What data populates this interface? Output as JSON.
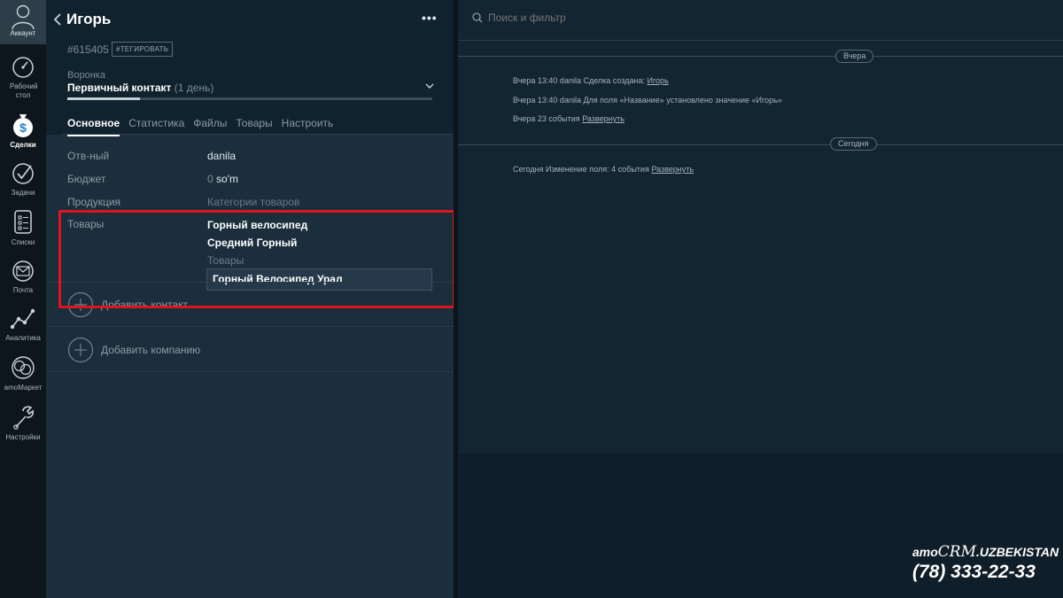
{
  "nav": {
    "account_label": "Аккаунт",
    "items": [
      {
        "id": "dashboard",
        "label": "Рабочий стол",
        "icon": "speedometer-icon"
      },
      {
        "id": "deals",
        "label": "Сделки",
        "icon": "money-bag-icon",
        "active": true
      },
      {
        "id": "tasks",
        "label": "Задачи",
        "icon": "checkmark-icon"
      },
      {
        "id": "lists",
        "label": "Списки",
        "icon": "list-icon"
      },
      {
        "id": "mail",
        "label": "Почта",
        "icon": "envelope-icon"
      },
      {
        "id": "analytics",
        "label": "Аналитика",
        "icon": "chart-line-icon"
      },
      {
        "id": "market",
        "label": "amoМаркет",
        "icon": "market-icon"
      },
      {
        "id": "settings",
        "label": "Настройки",
        "icon": "wrench-icon"
      }
    ]
  },
  "card": {
    "title": "Игорь",
    "menu_label": "•••",
    "deal_id": "#615405",
    "tag_button": "#ТЕГИРОВАТЬ",
    "funnel_label": "Воронка",
    "funnel_stage": "Первичный контакт",
    "funnel_days": "(1 день)",
    "funnel_progress": 0.2,
    "tabs": [
      "Основное",
      "Статистика",
      "Файлы",
      "Товары",
      "Настроить"
    ],
    "fields": {
      "responsible_label": "Отв-ный",
      "responsible_value": "danila",
      "budget_label": "Бюджет",
      "budget_amount": "0",
      "budget_currency": "so'm",
      "products_label": "Продукция",
      "products_placeholder": "Категории товаров",
      "goods_label": "Товары",
      "goods_items": [
        "Горный велосипед",
        "Средний Горный"
      ],
      "goods_placeholder": "Товары",
      "goods_input_value": "Горный Велосипед Урал"
    },
    "add_contact": "Добавить контакт",
    "add_company": "Добавить компанию"
  },
  "feed": {
    "search_placeholder": "Поиск и фильтр",
    "groups": [
      {
        "date": "Вчера",
        "events": [
          {
            "text": "Вчера 13:40 danila Сделка создана:",
            "link": "Игорь"
          },
          {
            "text": "Вчера 13:40 danila Для поля «Название» установлено значение «Игорь»",
            "link": ""
          },
          {
            "text": "Вчера 23 события",
            "link": "Развернуть"
          }
        ]
      },
      {
        "date": "Сегодня",
        "events": [
          {
            "text": "Сегодня Изменение поля: 4 события",
            "link": "Развернуть"
          }
        ]
      }
    ]
  },
  "brand": {
    "prefix": "amo",
    "crm": "CRM",
    "suffix": ".UZBEKISTAN",
    "phone": "(78) 333-22-33"
  },
  "colors": {
    "highlight": "#e0141e",
    "panel": "#1a2e3c",
    "feed": "#142532",
    "nav": "#0d161c"
  }
}
